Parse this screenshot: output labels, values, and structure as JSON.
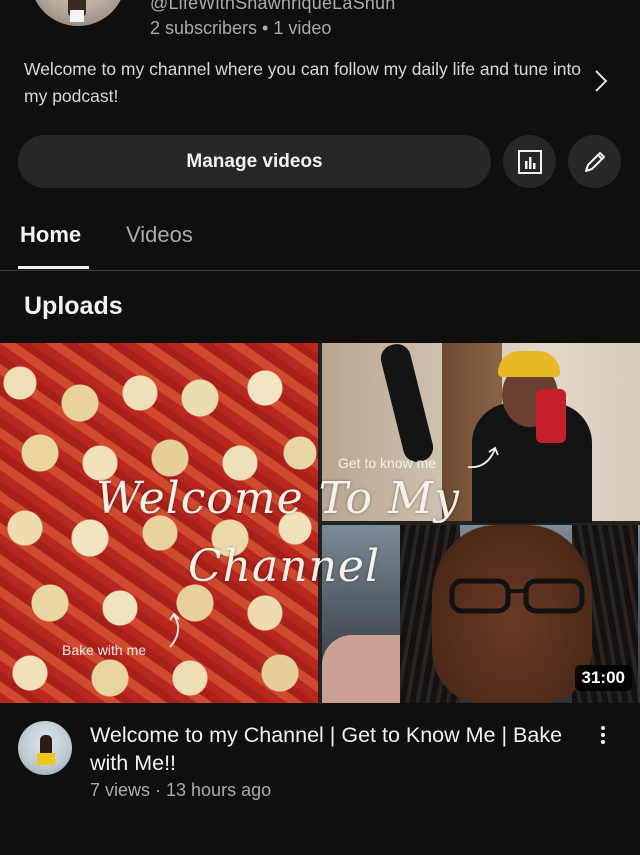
{
  "channel": {
    "handle": "@LifeWithShawnriqueLaShun",
    "stats": "2 subscribers • 1 video",
    "description": "Welcome to my channel where you can follow my daily life and tune into my podcast!"
  },
  "actions": {
    "manage_label": "Manage videos",
    "analytics_icon": "analytics-icon",
    "edit_icon": "edit-pencil-icon"
  },
  "tabs": [
    {
      "label": "Home",
      "active": true
    },
    {
      "label": "Videos",
      "active": false
    }
  ],
  "section": {
    "title": "Uploads"
  },
  "video": {
    "thumbnail_text": {
      "line1": "Welcome To My",
      "line2": "Channel",
      "note_get_to_know": "Get to know me",
      "note_bake": "Bake with me"
    },
    "duration": "31:00",
    "title": "Welcome to my Channel | Get to Know Me | Bake with Me!!",
    "meta": "7 views · 13 hours ago"
  },
  "colors": {
    "background": "#0f0f0f",
    "button_bg": "#272727",
    "text_primary": "#f1f1f1",
    "text_secondary": "#aaaaaa"
  }
}
